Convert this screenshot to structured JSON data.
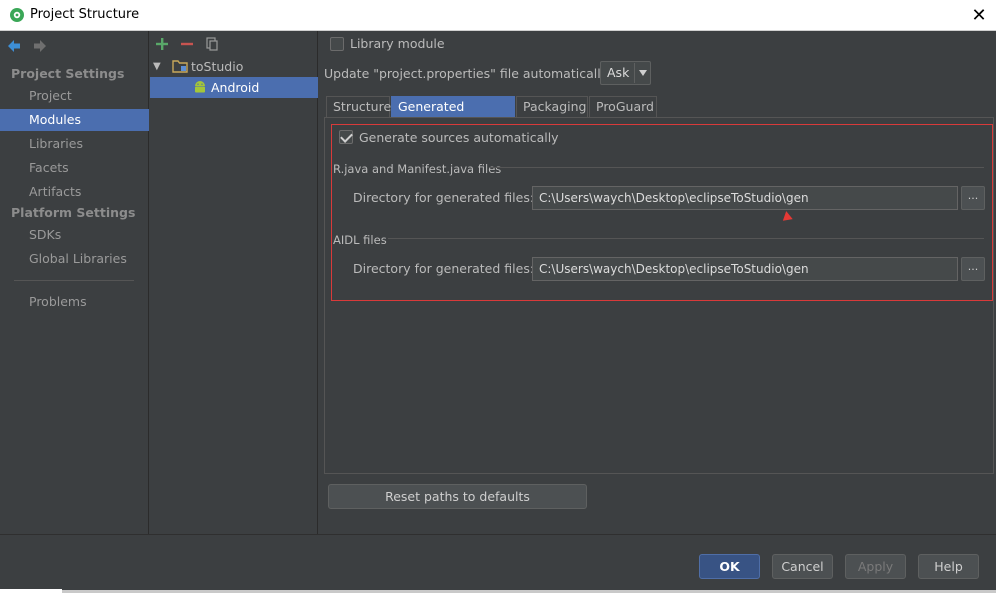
{
  "window": {
    "title": "Project Structure",
    "close_glyph": "✕"
  },
  "sidebar": {
    "project_settings_header": "Project Settings",
    "platform_settings_header": "Platform Settings",
    "items_project": [
      "Project",
      "Modules",
      "Libraries",
      "Facets",
      "Artifacts"
    ],
    "items_platform": [
      "SDKs",
      "Global Libraries"
    ],
    "problems": "Problems",
    "selected": "Modules"
  },
  "tree": {
    "root": "toStudio",
    "child": "Android"
  },
  "content": {
    "library_module_label": "Library module",
    "update_label": "Update \"project.properties\" file automatically:",
    "update_value": "Ask",
    "tabs": [
      "Structure",
      "Generated Sources",
      "Packaging",
      "ProGuard"
    ],
    "active_tab": "Generated Sources",
    "generate_auto_label": "Generate sources automatically",
    "rjava_group": "R.java and Manifest.java files",
    "aidl_group": "AIDL files",
    "dir_label": "Directory for generated files:",
    "rjava_dir": "C:\\Users\\waych\\Desktop\\eclipseToStudio\\gen",
    "aidl_dir": "C:\\Users\\waych\\Desktop\\eclipseToStudio\\gen",
    "browse_glyph": "...",
    "reset_button": "Reset paths to defaults"
  },
  "footer": {
    "ok": "OK",
    "cancel": "Cancel",
    "apply": "Apply",
    "help": "Help"
  },
  "colors": {
    "accent_selection": "#4b6eaf",
    "highlight_box": "#d93a3a",
    "background": "#3c3f41"
  }
}
